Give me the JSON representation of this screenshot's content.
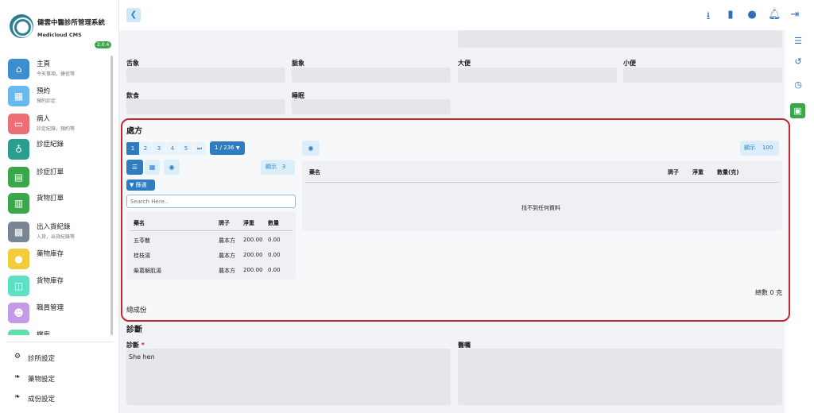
{
  "app": {
    "title": "健雲中醫診所管理系統",
    "subtitle": "Medicloud CMS",
    "version": "2.0.4"
  },
  "sidebar": {
    "items": [
      {
        "label": "主頁",
        "desc": "今天事項，捷徑等",
        "color": "#3b8ed0",
        "icon": "home-icon"
      },
      {
        "label": "預約",
        "desc": "預約診症",
        "color": "#69b9ee",
        "icon": "calendar-icon"
      },
      {
        "label": "病人",
        "desc": "診症紀錄，預約等",
        "color": "#ec6f76",
        "icon": "bed-icon"
      },
      {
        "label": "診症紀錄",
        "desc": "",
        "color": "#2a9d8f",
        "icon": "stethoscope-icon"
      },
      {
        "label": "診症訂單",
        "desc": "",
        "color": "#3aa84a",
        "icon": "document-icon"
      },
      {
        "label": "貨物訂單",
        "desc": "",
        "color": "#3aa84a",
        "icon": "order-icon"
      },
      {
        "label": "出入貨紀錄",
        "desc": "入貨，出貨紀錄等",
        "color": "#7a8593",
        "icon": "warehouse-icon"
      },
      {
        "label": "藥物庫存",
        "desc": "",
        "color": "#f2cc3a",
        "icon": "pills-icon"
      },
      {
        "label": "貨物庫存",
        "desc": "",
        "color": "#5ee0c4",
        "icon": "boxes-icon"
      },
      {
        "label": "職員管理",
        "desc": "",
        "color": "#c59be6",
        "icon": "staff-icon"
      },
      {
        "label": "檔案",
        "desc": "",
        "color": "#5ee0a8",
        "icon": "file-icon"
      }
    ],
    "bottom": [
      {
        "label": "診所設定",
        "icon": "gears-icon"
      },
      {
        "label": "藥物設定",
        "icon": "leaf-icon"
      },
      {
        "label": "成份設定",
        "icon": "leaf-icon"
      }
    ]
  },
  "form": {
    "tongue_label": "舌象",
    "pulse_label": "脈象",
    "stool_label": "大便",
    "urine_label": "小便",
    "diet_label": "飲食",
    "sleep_label": "睡眠"
  },
  "prescription": {
    "title": "處方",
    "pages": [
      "1",
      "2",
      "3",
      "4",
      "5"
    ],
    "page_indicator": "1 / 236",
    "show_label": "顯示",
    "show_count_left": "3",
    "show_count_right": "100",
    "filter_label": "篩選",
    "search_placeholder": "Search Here..",
    "left_table": {
      "headers": [
        "藥名",
        "牌子",
        "淨重",
        "數量"
      ],
      "rows": [
        [
          "五苓散",
          "農本方",
          "200.00",
          "0.00"
        ],
        [
          "桂枝湯",
          "農本方",
          "200.00",
          "0.00"
        ],
        [
          "柴葛解肌湯",
          "農本方",
          "200.00",
          "0.00"
        ]
      ]
    },
    "right_table": {
      "headers": [
        "藥名",
        "牌子",
        "淨重",
        "數量(克)"
      ],
      "empty_text": "找不到任何資料"
    },
    "total_text": "總數 0 克",
    "composition_label": "總成份"
  },
  "diagnosis": {
    "section_title": "診斷",
    "diag_label": "診斷",
    "required_mark": "*",
    "diag_value": "She hen",
    "advice_label": "醫囑"
  },
  "colors": {
    "accent": "#2f7cc0",
    "highlight_border": "#c4262e",
    "version_badge": "#3aa84a"
  }
}
